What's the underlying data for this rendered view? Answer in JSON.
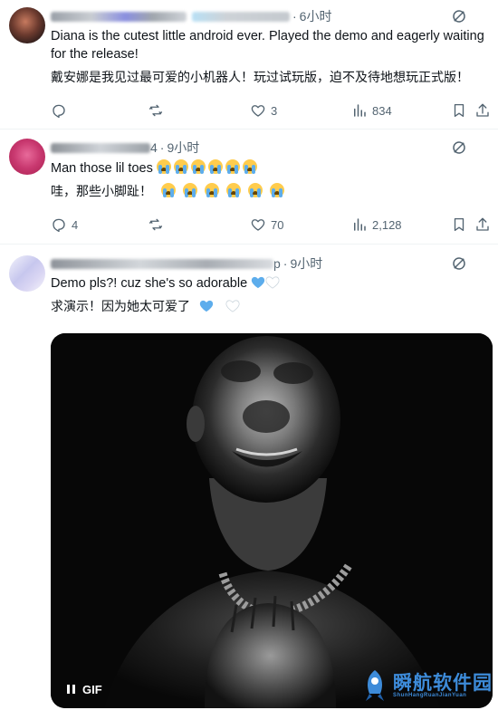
{
  "tweets": [
    {
      "time": "6小时",
      "text_en": "Diana is the cutest little android ever. Played the demo and eagerly waiting for the release!",
      "text_cn": "戴安娜是我见过最可爱的小机器人！玩过试玩版，迫不及待地想玩正式版！",
      "replies": "",
      "retweets": "",
      "likes": "3",
      "views": "834"
    },
    {
      "time": "9小时",
      "name_suffix": "4",
      "text_en": "Man those lil toes",
      "text_cn": "哇，那些小脚趾！",
      "replies": "4",
      "retweets": "",
      "likes": "70",
      "views": "2,128"
    },
    {
      "time": "9小时",
      "name_suffix": "p",
      "text_en": "Demo pls?! cuz she's so adorable",
      "text_cn": "求演示！因为她太可爱了",
      "media": {
        "badge_label": "GIF"
      }
    }
  ],
  "watermark": {
    "title": "瞬航软件园",
    "subtitle": "ShunHangRuanJianYuan"
  },
  "icons": {
    "more": "more-circle-icon",
    "reply": "reply-icon",
    "retweet": "retweet-icon",
    "like": "heart-icon",
    "views": "views-bar-chart-icon",
    "bookmark": "bookmark-icon",
    "share": "share-icon",
    "emoji_loud_cry": "loudly-crying-face-emoji",
    "heart_blue": "blue-heart-emoji",
    "heart_white": "white-heart-emoji"
  },
  "colors": {
    "text": "#0f1419",
    "secondary": "#536471",
    "divider": "#eff3f4",
    "emoji_face": "#ffcc4d",
    "tear": "#5dadec",
    "heart_blue": "#5dadec",
    "watermark": "#3d8bd9"
  }
}
